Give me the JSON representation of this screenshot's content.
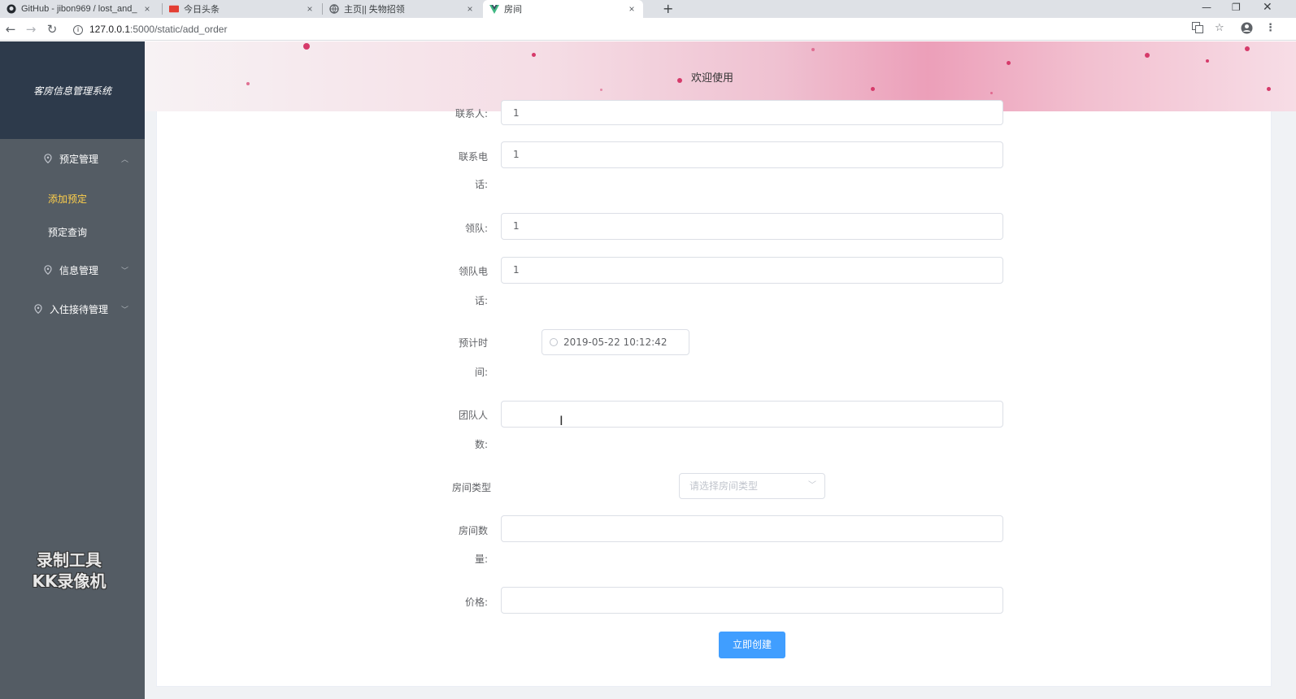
{
  "browser": {
    "tabs": [
      {
        "label": "GitHub - jibon969 / lost_and_",
        "icon": "github-icon"
      },
      {
        "label": "今日头条",
        "icon": "toutiao-icon"
      },
      {
        "label": "主页|| 失物招领",
        "icon": "globe-icon"
      },
      {
        "label": "房间",
        "icon": "vue-icon",
        "active": true
      }
    ],
    "url_host": "127.0.0.1",
    "url_path": ":5000/static/add_order"
  },
  "sidebar": {
    "brand": "客房信息管理系统",
    "menu": [
      {
        "label": "预定管理",
        "icon": "location-icon",
        "expanded": true,
        "children": [
          {
            "label": "添加预定",
            "active": true
          },
          {
            "label": "预定查询"
          }
        ]
      },
      {
        "label": "信息管理",
        "icon": "location-icon"
      },
      {
        "label": "入住接待管理",
        "icon": "location-icon"
      }
    ],
    "watermark_line1": "录制工具",
    "watermark_line2": "KK录像机"
  },
  "header": {
    "title": "欢迎使用"
  },
  "form": {
    "contact_label": "联系人:",
    "contact_value": "1",
    "contact_phone_label_1": "联系电",
    "contact_phone_label_2": "话:",
    "contact_phone_value": "1",
    "leader_label": "领队:",
    "leader_value": "1",
    "leader_phone_label_1": "领队电",
    "leader_phone_label_2": "话:",
    "leader_phone_value": "1",
    "expected_time_label_1": "预计时",
    "expected_time_label_2": "间:",
    "expected_time_value": "2019-05-22 10:12:42",
    "team_size_label_1": "团队人",
    "team_size_label_2": "数:",
    "team_size_value": "",
    "room_type_label": "房间类型",
    "room_type_placeholder": "请选择房间类型",
    "room_count_label_1": "房间数",
    "room_count_label_2": "量:",
    "room_count_value": "",
    "price_label": "价格:",
    "price_value": "",
    "submit_label": "立即创建"
  },
  "colors": {
    "sidebar_bg": "#545c64",
    "brand_bg": "#2d3a4b",
    "active_menu": "#ffd04b",
    "primary": "#409eff"
  }
}
